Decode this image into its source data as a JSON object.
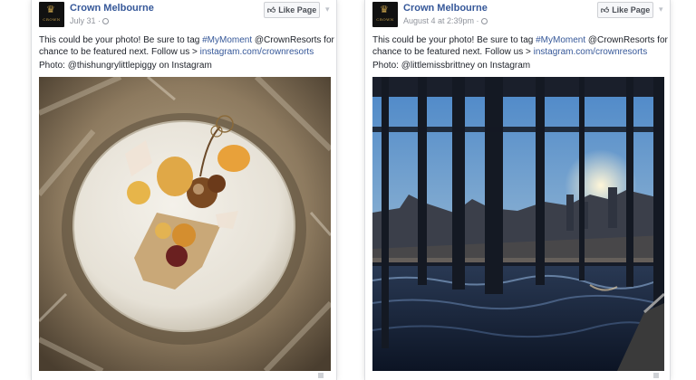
{
  "posts": [
    {
      "page_name": "Crown Melbourne",
      "date": "July 31 ·",
      "like_label": "Like Page",
      "text_line1_pre": "This could be your photo! Be sure to tag ",
      "hashtag": "#MyMoment",
      "text_line1_post": " @CrownResorts for a",
      "text_line2_pre": "chance to be featured next. Follow us > ",
      "link": "instagram.com/crownresorts",
      "credit": "Photo: @thishungrylittlepiggy on Instagram",
      "photo_icon": "plated-dessert-photo"
    },
    {
      "page_name": "Crown Melbourne",
      "date": "August 4 at 2:39pm ·",
      "like_label": "Like Page",
      "text_line1_pre": "This could be your photo! Be sure to tag ",
      "hashtag": "#MyMoment",
      "text_line1_post": " @CrownResorts for a",
      "text_line2_pre": "chance to be featured next. Follow us > ",
      "link": "instagram.com/crownresorts",
      "credit": "Photo: @littlemissbrittney on Instagram",
      "photo_icon": "infinity-pool-sunset-photo"
    }
  ],
  "avatar": {
    "logo_text": "CROWN"
  },
  "colors": {
    "link": "#365899",
    "meta": "#90949c",
    "text": "#1d2129"
  }
}
